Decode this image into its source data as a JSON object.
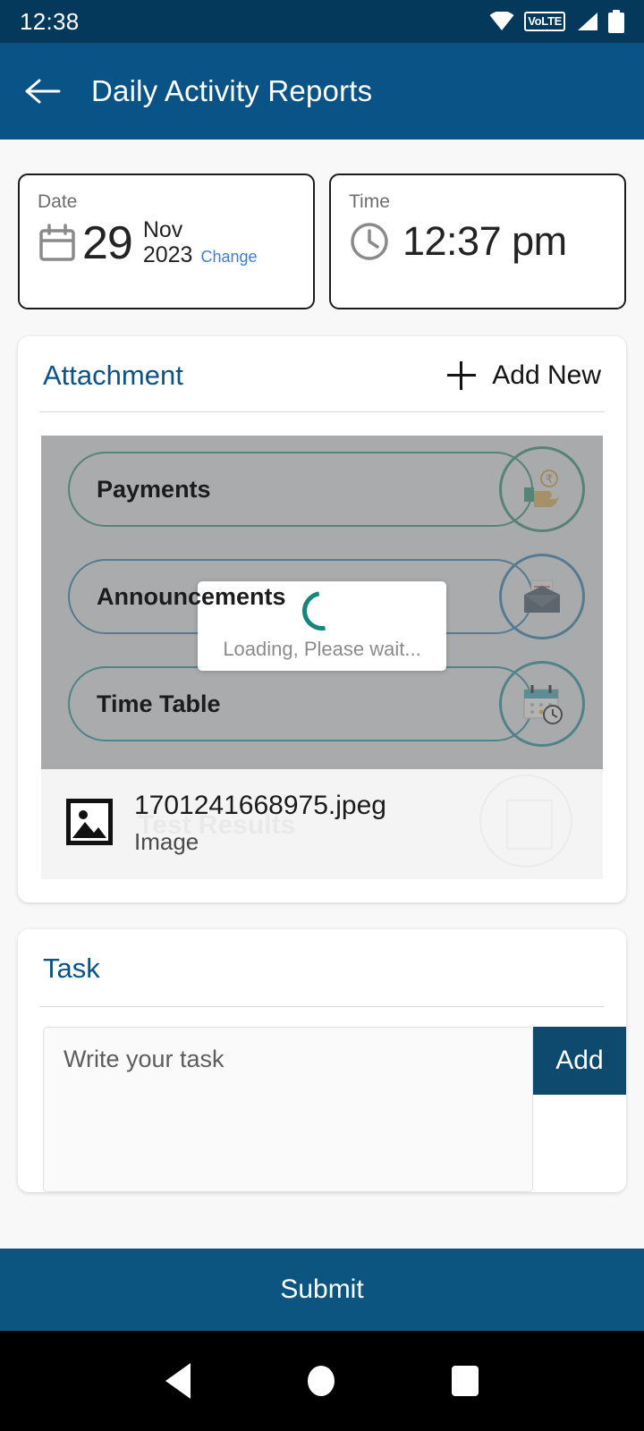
{
  "status_bar": {
    "time": "12:38",
    "icons": [
      "wifi-icon",
      "volte-icon",
      "signal-icon",
      "battery-icon"
    ],
    "volte_label": "VoLTE",
    "bg": "#05395c"
  },
  "app_bar": {
    "back_icon": "back-arrow-icon",
    "title": "Daily Activity Reports",
    "bg": "#0a5386"
  },
  "date_card": {
    "label": "Date",
    "icon": "calendar-icon",
    "day": "29",
    "month": "Nov",
    "year": "2023",
    "change_label": "Change",
    "change_color": "#3b7edb"
  },
  "time_card": {
    "label": "Time",
    "icon": "clock-icon",
    "value": "12:37 pm"
  },
  "attachment": {
    "title": "Attachment",
    "title_color": "#0a5386",
    "add_new_label": "Add New",
    "add_icon": "plus-icon",
    "preview": {
      "tiles": [
        {
          "label": "Payments",
          "icon": "rupee-hand-icon",
          "accent": "#2f8f74"
        },
        {
          "label": "Announcements",
          "icon": "envelope-icon",
          "accent": "#2b7db5"
        },
        {
          "label": "Time Table",
          "icon": "calendar-clock-icon",
          "accent": "#1e8fa0"
        }
      ],
      "ghost_label": "Test Results",
      "dialog": {
        "text": "Loading, Please wait...",
        "spinner_color": "#16857b"
      }
    },
    "file": {
      "icon": "image-file-icon",
      "name": "1701241668975.jpeg",
      "type": "Image"
    }
  },
  "task": {
    "title": "Task",
    "title_color": "#0a5386",
    "placeholder": "Write your task",
    "value": "",
    "add_label": "Add",
    "add_bg": "#0e4a6e"
  },
  "submit": {
    "label": "Submit",
    "bg": "#0b5580"
  },
  "nav_bar": {
    "back_icon": "nav-back-icon",
    "home_icon": "nav-home-icon",
    "recents_icon": "nav-recents-icon"
  }
}
